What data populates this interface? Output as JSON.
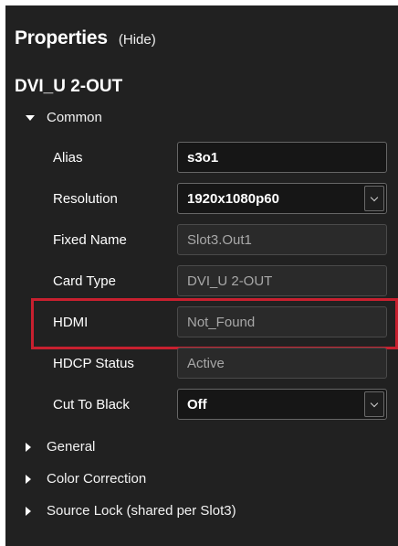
{
  "panel": {
    "title": "Properties",
    "hide_label": "(Hide)",
    "device_name": "DVI_U 2-OUT"
  },
  "groups": {
    "common": "Common",
    "general": "General",
    "color_correction": "Color Correction",
    "source_lock": "Source Lock (shared per Slot3)"
  },
  "properties": {
    "alias": {
      "label": "Alias",
      "value": "s3o1"
    },
    "resolution": {
      "label": "Resolution",
      "value": "1920x1080p60"
    },
    "fixed_name": {
      "label": "Fixed Name",
      "value": "Slot3.Out1"
    },
    "card_type": {
      "label": "Card Type",
      "value": "DVI_U 2-OUT"
    },
    "hdmi": {
      "label": "HDMI",
      "value": "Not_Found"
    },
    "hdcp_status": {
      "label": "HDCP Status",
      "value": "Active"
    },
    "cut_to_black": {
      "label": "Cut To Black",
      "value": "Off"
    }
  },
  "colors": {
    "panel_background": "#212121",
    "highlight_border": "#c8202f"
  },
  "icons": {
    "expanded": "triangle-down-icon",
    "collapsed": "triangle-right-icon",
    "dropdown": "chevron-down-icon"
  }
}
